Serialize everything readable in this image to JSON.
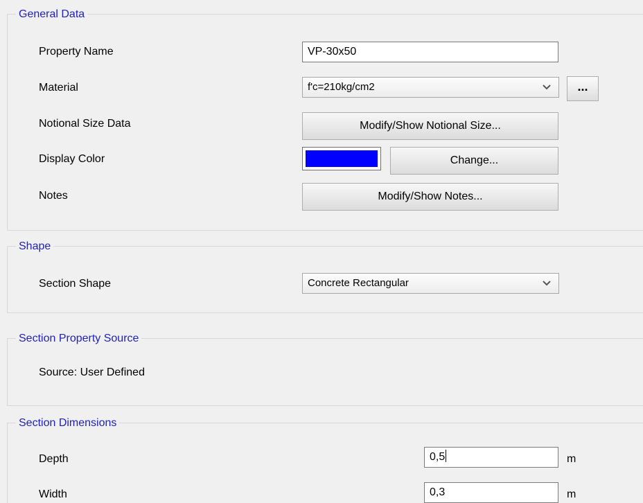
{
  "general_data": {
    "title": "General Data",
    "property_name_label": "Property Name",
    "property_name_value": "VP-30x50",
    "material_label": "Material",
    "material_selected": "f'c=210kg/cm2",
    "material_more_button": "...",
    "notional_size_label": "Notional Size Data",
    "notional_size_button": "Modify/Show Notional Size...",
    "display_color_label": "Display Color",
    "display_color_value": "#0000ff",
    "change_color_button": "Change...",
    "notes_label": "Notes",
    "notes_button": "Modify/Show Notes..."
  },
  "shape": {
    "title": "Shape",
    "section_shape_label": "Section Shape",
    "section_shape_selected": "Concrete Rectangular"
  },
  "section_property_source": {
    "title": "Section Property Source",
    "source_text": "Source:  User Defined"
  },
  "section_dimensions": {
    "title": "Section Dimensions",
    "depth_label": "Depth",
    "depth_value": "0,5",
    "depth_unit": "m",
    "width_label": "Width",
    "width_value": "0,3",
    "width_unit": "m"
  },
  "colors": {
    "group_title_color": "#1f1fb8",
    "display_color": "#0000ff"
  },
  "icons": {
    "dropdown_icon": "chevron-down-icon"
  }
}
